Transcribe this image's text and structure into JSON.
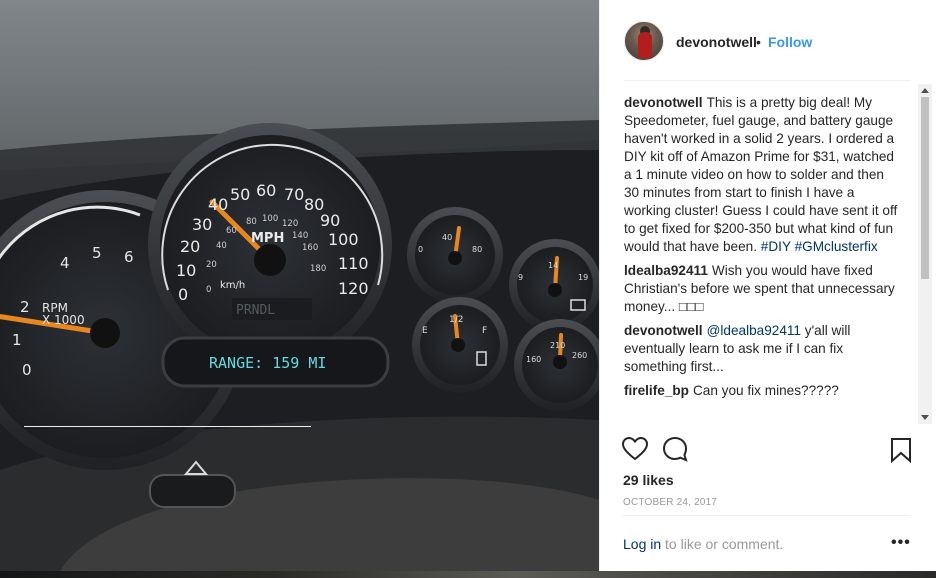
{
  "post": {
    "username": "devonotwell",
    "separator": "•",
    "follow_label": "Follow",
    "comments": [
      {
        "user": "devonotwell",
        "text": "This is a pretty big deal! My Speedometer, fuel gauge, and battery gauge haven't worked in a solid 2 years. I ordered a DIY kit off of Amazon Prime for $31, watched a 1 minute video on how to solder and then 30 minutes from start to finish I have a working cluster! Guess I could have sent it off to get fixed for $200-350 but what kind of fun would that have been. ",
        "tags": [
          "#DIY",
          "#GMclusterfix"
        ]
      },
      {
        "user": "ldealba92411",
        "text": "Wish you would have fixed Christian's before we spent that unnecessary money... □□□"
      },
      {
        "user": "devonotwell",
        "mention": "@ldealba92411",
        "text": " y'all will eventually learn to ask me if I can fix something first..."
      },
      {
        "user": "firelife_bp",
        "text": "Can you fix mines?????"
      }
    ],
    "likes": "29 likes",
    "date": "OCTOBER 24, 2017",
    "login_link": "Log in",
    "login_rest": " to like or comment.",
    "more_label": "•••"
  },
  "photo": {
    "tach_labels": [
      "0",
      "1",
      "2",
      "4",
      "5",
      "6"
    ],
    "tach_text_1": "RPM",
    "tach_text_2": "X 1000",
    "speed_labels_mph": [
      "0",
      "10",
      "20",
      "30",
      "40",
      "50",
      "60",
      "70",
      "80",
      "90",
      "100",
      "110",
      "120"
    ],
    "speed_labels_kmh": [
      "0",
      "20",
      "40",
      "60",
      "80",
      "100",
      "120",
      "140",
      "160",
      "180"
    ],
    "speed_unit": "MPH",
    "speed_unit_2": "km/h",
    "gear_text": "PRNDL",
    "range_display": "RANGE: 159 MI",
    "oil_labels": [
      "0",
      "40",
      "80"
    ],
    "fuel_labels": [
      "E",
      "1/2",
      "F"
    ],
    "volt_labels": [
      "9",
      "14",
      "19"
    ],
    "temp_labels": [
      "160",
      "210",
      "260"
    ]
  },
  "icons": {
    "like": "heart-icon",
    "comment": "speech-bubble-icon",
    "save": "bookmark-icon"
  },
  "colors": {
    "link": "#3897f0",
    "tag": "#003569",
    "needle": "#e8871e",
    "display": "#63d9e0"
  }
}
